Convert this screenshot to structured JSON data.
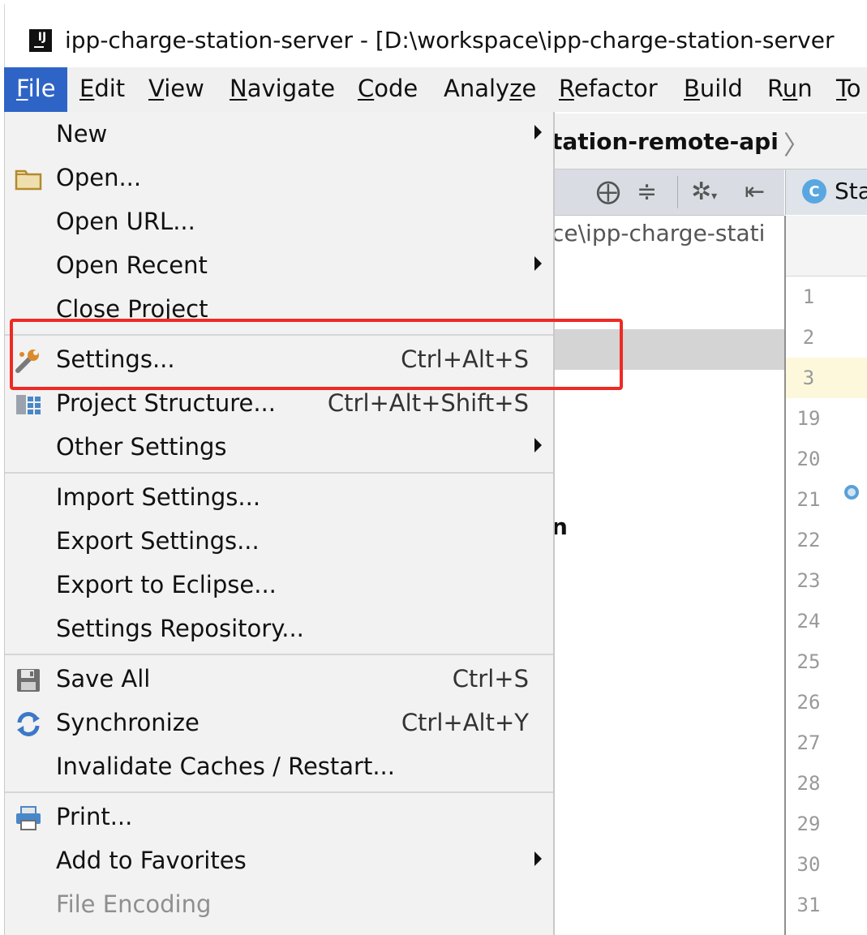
{
  "window": {
    "title": "ipp-charge-station-server - [D:\\workspace\\ipp-charge-station-server",
    "app_icon_text": "IJ"
  },
  "menubar": {
    "items": [
      {
        "label": "File",
        "mnemonic": "F",
        "active": true
      },
      {
        "label": "Edit",
        "mnemonic": "E"
      },
      {
        "label": "View",
        "mnemonic": "V"
      },
      {
        "label": "Navigate",
        "mnemonic": "N"
      },
      {
        "label": "Code",
        "mnemonic": "C"
      },
      {
        "label": "Analyze",
        "mnemonic": "z"
      },
      {
        "label": "Refactor",
        "mnemonic": "R"
      },
      {
        "label": "Build",
        "mnemonic": "B"
      },
      {
        "label": "Run",
        "mnemonic": "u"
      },
      {
        "label": "To",
        "mnemonic": "T"
      }
    ]
  },
  "background": {
    "nav_breadcrumb": "tation-remote-api",
    "editor_tab_letter": "C",
    "editor_tab_label": "Sta",
    "project_path": "ce\\ipp-charge-stati",
    "project_node_fragment": "n",
    "line_numbers": [
      "1",
      "2",
      "3",
      "19",
      "20",
      "21",
      "22",
      "23",
      "24",
      "25",
      "26",
      "27",
      "28",
      "29",
      "30",
      "31"
    ]
  },
  "file_menu": {
    "items": [
      {
        "label": "New",
        "submenu": true
      },
      {
        "label": "Open...",
        "icon": "folder-icon"
      },
      {
        "label": "Open URL..."
      },
      {
        "label": "Open Recent",
        "submenu": true
      },
      {
        "label": "Close Project"
      },
      {
        "label": "Settings...",
        "shortcut": "Ctrl+Alt+S",
        "icon": "wrench-icon"
      },
      {
        "label": "Project Structure...",
        "shortcut": "Ctrl+Alt+Shift+S",
        "icon": "project-structure-icon"
      },
      {
        "label": "Other Settings",
        "submenu": true
      },
      {
        "label": "Import Settings..."
      },
      {
        "label": "Export Settings..."
      },
      {
        "label": "Export to Eclipse..."
      },
      {
        "label": "Settings Repository..."
      },
      {
        "label": "Save All",
        "shortcut": "Ctrl+S",
        "icon": "save-icon"
      },
      {
        "label": "Synchronize",
        "shortcut": "Ctrl+Alt+Y",
        "icon": "sync-icon"
      },
      {
        "label": "Invalidate Caches / Restart..."
      },
      {
        "label": "Print...",
        "icon": "printer-icon"
      },
      {
        "label": "Add to Favorites",
        "submenu": true
      },
      {
        "label": "File Encoding",
        "disabled": true
      }
    ]
  },
  "colors": {
    "menu_active": "#2f64c7",
    "annotation_box": "#ee2a24",
    "menu_background": "#f2f2f2"
  }
}
